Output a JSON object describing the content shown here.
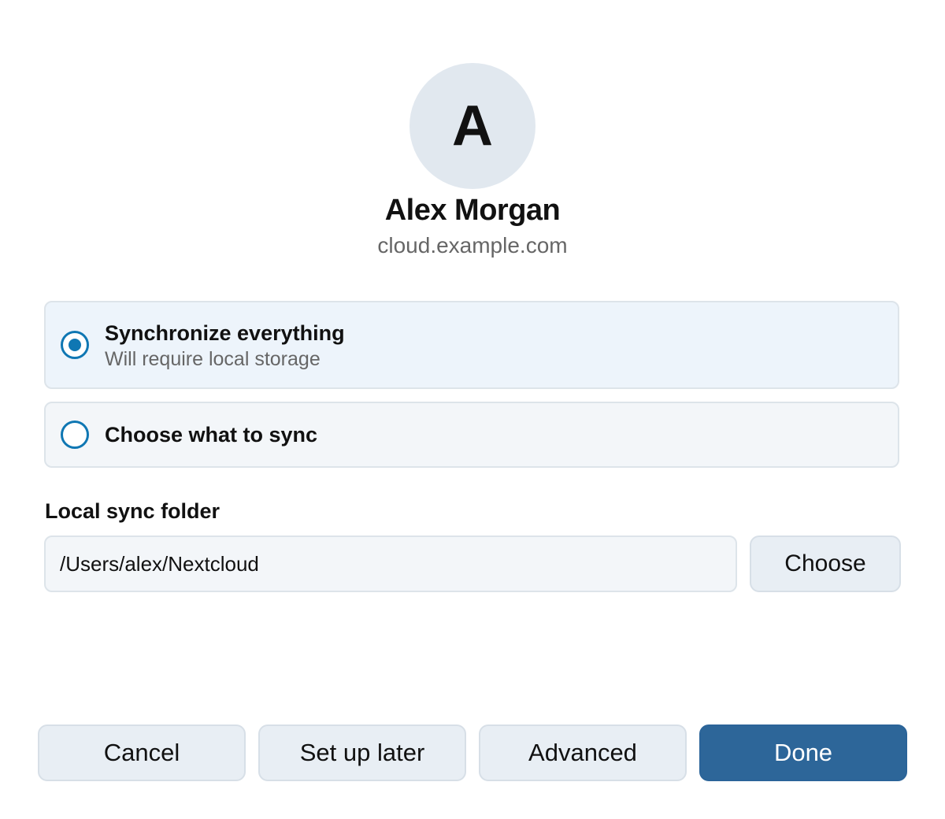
{
  "account": {
    "avatar_initial": "A",
    "name": "Alex Morgan",
    "server": "cloud.example.com"
  },
  "sync_options": {
    "selected": "everything",
    "everything": {
      "title": "Synchronize everything",
      "subtitle": "Will require local storage"
    },
    "choose": {
      "title": "Choose what to sync"
    }
  },
  "local_folder": {
    "label": "Local sync folder",
    "value": "/Users/alex/Nextcloud",
    "choose_label": "Choose"
  },
  "footer": {
    "cancel_label": "Cancel",
    "later_label": "Set up later",
    "advanced_label": "Advanced",
    "done_label": "Done"
  },
  "colors": {
    "accent": "#0f77b3",
    "primary_button": "#2d6699",
    "option_background": "#f3f6f9",
    "avatar_background": "#e1e8ef"
  },
  "icons": {
    "selected_radio": "radio-checked-icon",
    "unselected_radio": "radio-unchecked-icon"
  }
}
